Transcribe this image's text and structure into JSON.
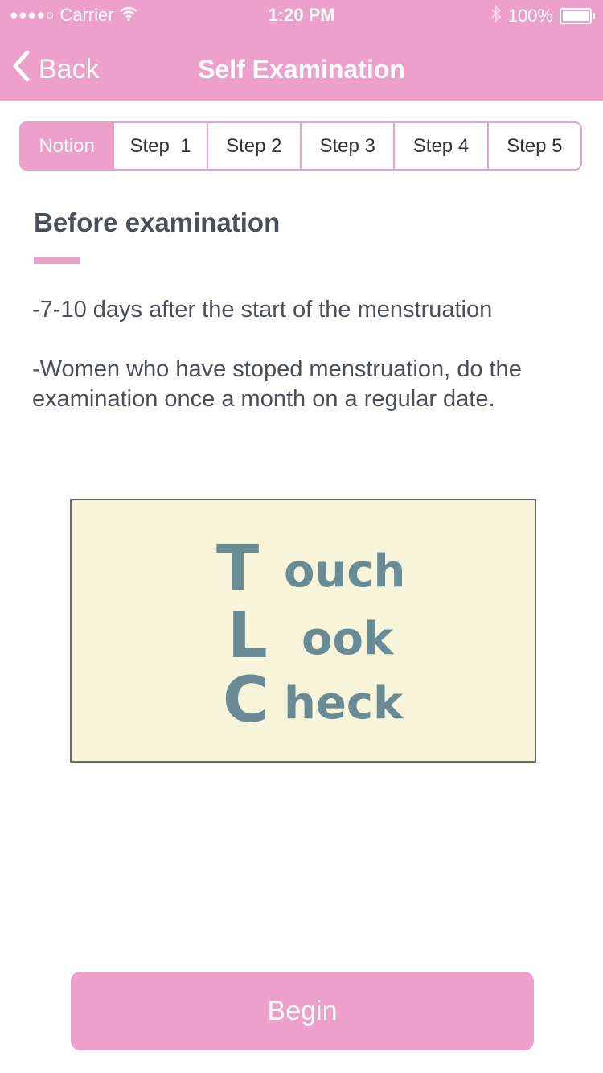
{
  "status_bar": {
    "signal": "●●●●○",
    "carrier": "Carrier",
    "wifi": "wifi-icon",
    "time": "1:20 PM",
    "bluetooth": "bluetooth-icon",
    "battery_text": "100%",
    "battery_level": 1.0
  },
  "navbar": {
    "back_label": "Back",
    "title": "Self Examination",
    "color": "#eda0c9"
  },
  "tabs": [
    {
      "label": "Notion",
      "active": true
    },
    {
      "label": "Step  1",
      "active": false
    },
    {
      "label": "Step 2",
      "active": false
    },
    {
      "label": "Step 3",
      "active": false
    },
    {
      "label": "Step 4",
      "active": false
    },
    {
      "label": "Step 5",
      "active": false
    }
  ],
  "content": {
    "section_title": "Before examination",
    "paragraph1": "-7-10 days after the start of the menstruation",
    "paragraph2": "-Women who have stoped menstruation, do the examination once a month on a regular date."
  },
  "tlc_image": {
    "lines": [
      {
        "initial": "T",
        "rest": "ouch"
      },
      {
        "initial": "L",
        "rest": "ook"
      },
      {
        "initial": "C",
        "rest": "heck"
      }
    ],
    "text_color": "#688c96",
    "background": "#f7f5d9"
  },
  "begin_button": {
    "label": "Begin"
  }
}
